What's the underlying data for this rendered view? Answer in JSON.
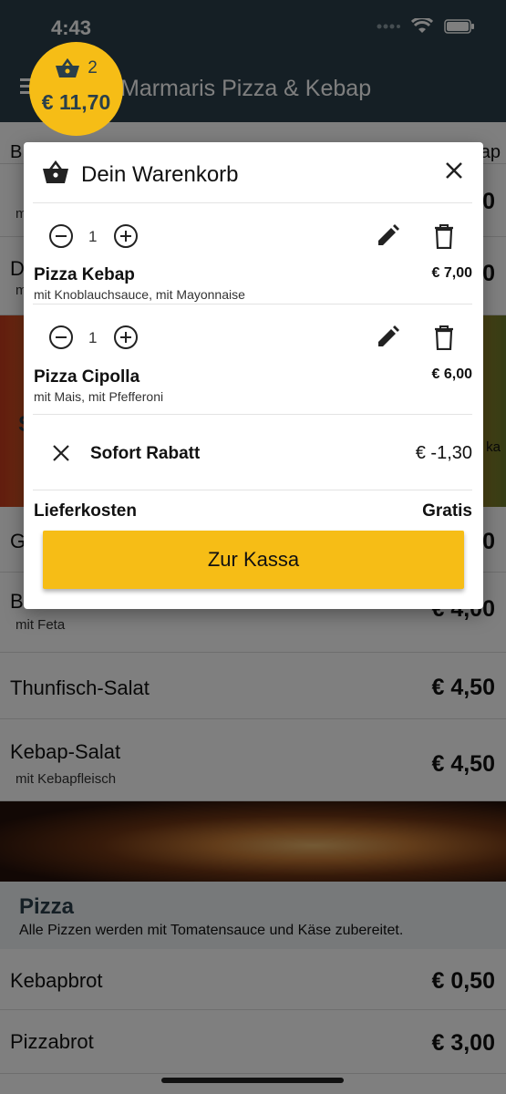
{
  "status_bar": {
    "time": "4:43"
  },
  "app_bar": {
    "title": "Marmaris Pizza & Kebap"
  },
  "cart_badge": {
    "count": "2",
    "total": "€ 11,70"
  },
  "background": {
    "category_tabs": [
      "B",
      "",
      "",
      "ap"
    ],
    "rows": [
      {
        "name": "",
        "sub": "m",
        "price": "0"
      },
      {
        "name": "D",
        "sub": "m",
        "price": "0"
      },
      {
        "name": "G",
        "sub": "",
        "price": "0"
      },
      {
        "name": "Bauern-Salat",
        "sub": "mit Feta",
        "price": "€ 4,00"
      },
      {
        "name": "Thunfisch-Salat",
        "sub": "",
        "price": "€ 4,50"
      },
      {
        "name": "Kebap-Salat",
        "sub": "mit Kebapfleisch",
        "price": "€ 4,50"
      },
      {
        "name": "Kebapbrot",
        "sub": "",
        "price": "€ 0,50"
      },
      {
        "name": "Pizzabrot",
        "sub": "",
        "price": "€ 3,00"
      }
    ],
    "photo_section_initial": "S",
    "photo_side_text": "ka",
    "pizza_section": {
      "title": "Pizza",
      "subtitle": "Alle Pizzen werden mit Tomatensauce und Käse zubereitet."
    }
  },
  "cart_modal": {
    "title": "Dein Warenkorb",
    "items": [
      {
        "qty": "1",
        "name": "Pizza Kebap",
        "options": "mit Knoblauchsauce, mit Mayonnaise",
        "price": "€ 7,00"
      },
      {
        "qty": "1",
        "name": "Pizza Cipolla",
        "options": "mit Mais, mit Pfefferoni",
        "price": "€ 6,00"
      }
    ],
    "discount": {
      "label": "Sofort Rabatt",
      "value": "€ -1,30"
    },
    "delivery": {
      "label": "Lieferkosten",
      "value": "Gratis"
    },
    "checkout_label": "Zur Kassa"
  },
  "colors": {
    "app_bar": "#2a3f4a",
    "accent": "#f6bd16"
  }
}
